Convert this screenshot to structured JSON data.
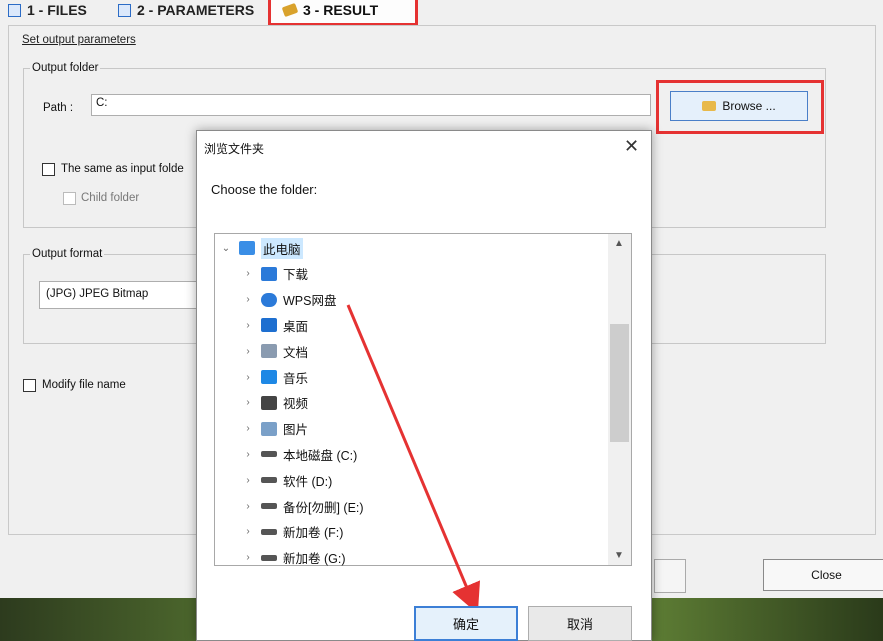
{
  "tabs": [
    {
      "label": "1 - FILES"
    },
    {
      "label": "2 - PARAMETERS"
    },
    {
      "label": "3 - RESULT"
    }
  ],
  "main": {
    "set_output_link": "Set output parameters",
    "output_folder": {
      "legend": "Output folder",
      "path_label": "Path :",
      "path_value": "C:",
      "browse_label": "Browse ...",
      "same_as_input_label": "The same as input folde",
      "child_folder_label": "Child folder"
    },
    "output_format": {
      "legend": "Output format",
      "selected": "(JPG) JPEG Bitmap"
    },
    "modify_file_name_label": "Modify file name"
  },
  "dialog": {
    "title": "浏览文件夹",
    "prompt": "Choose the folder:",
    "tree": [
      {
        "label": "此电脑",
        "icon": "computer-icon",
        "color": "#3a8ee6"
      },
      {
        "label": "下载",
        "icon": "download-icon",
        "color": "#2b7ad9"
      },
      {
        "label": "WPS网盘",
        "icon": "cloud-icon",
        "color": "#2b7ad9"
      },
      {
        "label": "桌面",
        "icon": "desktop-icon",
        "color": "#1e6fd0"
      },
      {
        "label": "文档",
        "icon": "document-icon",
        "color": "#8a9bb0"
      },
      {
        "label": "音乐",
        "icon": "music-icon",
        "color": "#1e88e5"
      },
      {
        "label": "视频",
        "icon": "video-icon",
        "color": "#444444"
      },
      {
        "label": "图片",
        "icon": "picture-icon",
        "color": "#7aa0c8"
      },
      {
        "label": "本地磁盘 (C:)",
        "icon": "system-drive-icon",
        "color": "#555555"
      },
      {
        "label": "软件 (D:)",
        "icon": "drive-icon",
        "color": "#555555"
      },
      {
        "label": "备份[勿删] (E:)",
        "icon": "drive-icon",
        "color": "#555555"
      },
      {
        "label": "新加卷 (F:)",
        "icon": "drive-icon",
        "color": "#555555"
      },
      {
        "label": "新加卷 (G:)",
        "icon": "drive-icon",
        "color": "#555555"
      }
    ],
    "ok_label": "确定",
    "cancel_label": "取消"
  },
  "footer": {
    "close_label": "Close"
  },
  "colors": {
    "highlight": "#e53232",
    "accent": "#3c7fd6"
  }
}
